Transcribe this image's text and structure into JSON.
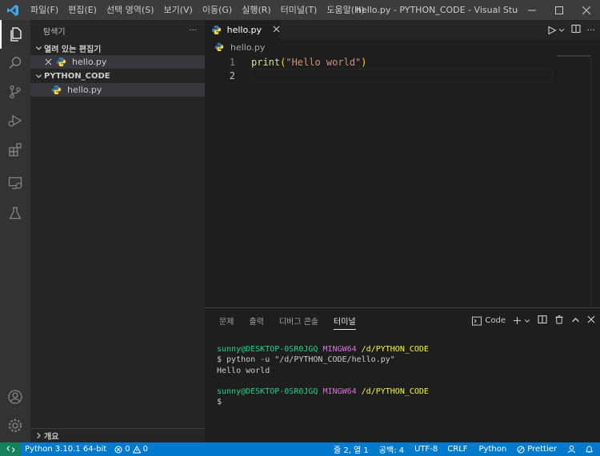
{
  "titlebar": {
    "menu": [
      "파일(F)",
      "편집(E)",
      "선택 영역(S)",
      "보기(V)",
      "이동(G)",
      "실행(R)",
      "터미널(T)",
      "도움말(H)"
    ],
    "window_title": "hello.py - PYTHON_CODE - Visual Studio Co..."
  },
  "activity_icons": [
    "explorer-icon",
    "search-icon",
    "source-control-icon",
    "run-debug-icon",
    "extensions-icon",
    "remote-explorer-icon",
    "testing-icon",
    "account-icon",
    "settings-gear-icon"
  ],
  "sidebar": {
    "title": "탐색기",
    "more": "···",
    "open_editors_label": "열려 있는 편집기",
    "open_editors": [
      {
        "name": "hello.py"
      }
    ],
    "folder_label": "PYTHON_CODE",
    "files": [
      {
        "name": "hello.py"
      }
    ],
    "outline_label": "개요"
  },
  "editor": {
    "tab_label": "hello.py",
    "breadcrumb": "hello.py",
    "lines": [
      {
        "no": "1",
        "fn": "print",
        "open": "(",
        "str": "\"Hello world\"",
        "close": ")"
      },
      {
        "no": "2"
      }
    ]
  },
  "panel": {
    "tabs": [
      "문제",
      "출력",
      "디버그 콘솔",
      "터미널"
    ],
    "active_tab": "터미널",
    "terminal_selector": "Code",
    "terminal": {
      "user1": "sunny@DESKTOP-0SR0JGQ",
      "env1": "MINGW64",
      "path1": "/d/PYTHON_CODE",
      "cmd": "$ python -u \"/d/PYTHON_CODE/hello.py\"",
      "output": "Hello world",
      "user2": "sunny@DESKTOP-0SR0JGQ",
      "env2": "MINGW64",
      "path2": "/d/PYTHON_CODE",
      "prompt": "$"
    }
  },
  "statusbar": {
    "python": "Python 3.10.1 64-bit",
    "errors": "0",
    "warnings": "0",
    "position": "줄 2, 열 1",
    "spaces": "공백: 4",
    "encoding": "UTF-8",
    "eol": "CRLF",
    "language": "Python",
    "prettier": "Prettier"
  },
  "colors": {
    "statusbar": "#007acc",
    "remote": "#16825d",
    "activity": "#333333",
    "sidebar": "#252526",
    "editor": "#1e1e1e"
  }
}
